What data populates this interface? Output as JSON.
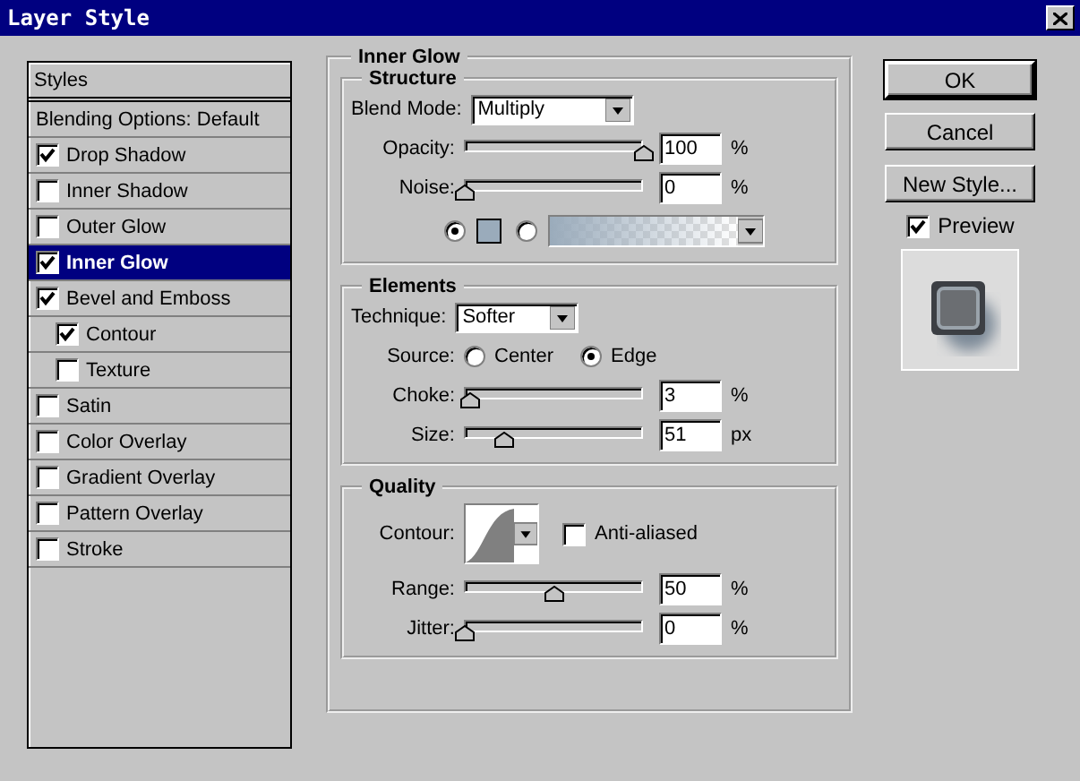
{
  "window": {
    "title": "Layer Style"
  },
  "styles": {
    "header": "Styles",
    "items": [
      {
        "label": "Blending Options: Default",
        "kind": "plain",
        "selected": false
      },
      {
        "label": "Drop Shadow",
        "kind": "check",
        "checked": true,
        "selected": false
      },
      {
        "label": "Inner Shadow",
        "kind": "check",
        "checked": false,
        "selected": false
      },
      {
        "label": "Outer Glow",
        "kind": "check",
        "checked": false,
        "selected": false
      },
      {
        "label": "Inner Glow",
        "kind": "check",
        "checked": true,
        "selected": true
      },
      {
        "label": "Bevel and Emboss",
        "kind": "check",
        "checked": true,
        "selected": false,
        "children": [
          {
            "label": "Contour",
            "kind": "check",
            "checked": true,
            "selected": false
          },
          {
            "label": "Texture",
            "kind": "check",
            "checked": false,
            "selected": false
          }
        ]
      },
      {
        "label": "Satin",
        "kind": "check",
        "checked": false,
        "selected": false
      },
      {
        "label": "Color Overlay",
        "kind": "check",
        "checked": false,
        "selected": false
      },
      {
        "label": "Gradient Overlay",
        "kind": "check",
        "checked": false,
        "selected": false
      },
      {
        "label": "Pattern Overlay",
        "kind": "check",
        "checked": false,
        "selected": false
      },
      {
        "label": "Stroke",
        "kind": "check",
        "checked": false,
        "selected": false
      }
    ]
  },
  "panel": {
    "title": "Inner Glow",
    "structure": {
      "title": "Structure",
      "blend_mode": {
        "label": "Blend Mode:",
        "value": "Multiply"
      },
      "opacity": {
        "label": "Opacity:",
        "level": 1,
        "value": "100",
        "unit": "%"
      },
      "noise": {
        "label": "Noise:",
        "level": 0,
        "value": "0",
        "unit": "%"
      },
      "fill": [
        {
          "kind": "color",
          "selected": true,
          "color": "#9aabbb"
        },
        {
          "kind": "gradient",
          "selected": false
        }
      ]
    },
    "elements": {
      "title": "Elements",
      "technique": {
        "label": "Technique:",
        "value": "Softer"
      },
      "source": {
        "label": "Source:",
        "options": [
          {
            "label": "Center",
            "selected": false
          },
          {
            "label": "Edge",
            "selected": true
          }
        ]
      },
      "choke": {
        "label": "Choke:",
        "level": 0.03,
        "value": "3",
        "unit": "%"
      },
      "size": {
        "label": "Size:",
        "level": 0.22,
        "value": "51",
        "unit": "px"
      }
    },
    "quality": {
      "title": "Quality",
      "contour": {
        "label": "Contour:"
      },
      "anti_aliased": {
        "label": "Anti-aliased",
        "checked": false
      },
      "range": {
        "label": "Range:",
        "level": 0.5,
        "value": "50",
        "unit": "%"
      },
      "jitter": {
        "label": "Jitter:",
        "level": 0,
        "value": "0",
        "unit": "%"
      }
    }
  },
  "buttons": [
    {
      "label": "OK",
      "default": true
    },
    {
      "label": "Cancel",
      "default": false
    },
    {
      "label": "New Style...",
      "default": false
    }
  ],
  "preview": {
    "label": "Preview",
    "checked": true
  }
}
